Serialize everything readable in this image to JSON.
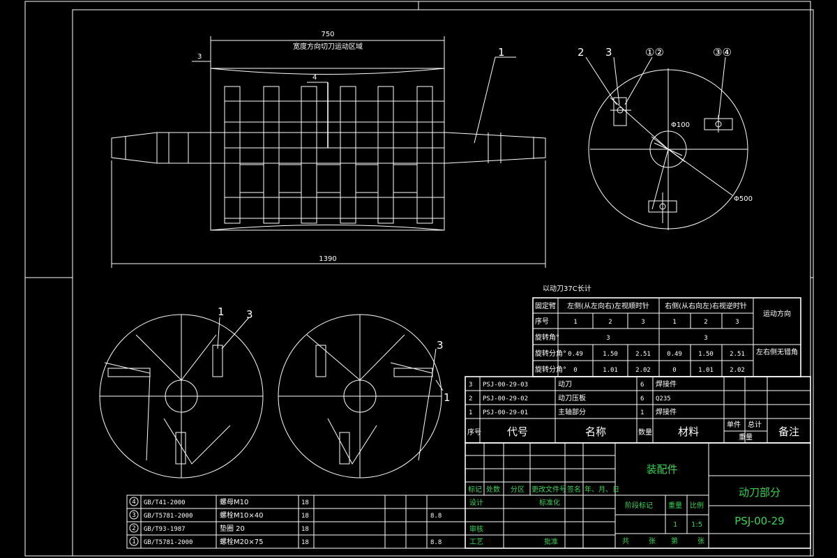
{
  "colors": {
    "background": "#000000",
    "lines": "#ffffff",
    "title_text": "#39d353"
  },
  "front_view": {
    "dim_total_top": "750",
    "region_label": "宽度方向切刀运动区域",
    "dim_gap": "3",
    "dim_slot": "4",
    "dim_total_bottom": "1390",
    "part_callout": "1"
  },
  "side_view": {
    "callouts": [
      "2",
      "3",
      "①②",
      "③④"
    ],
    "dim_shaft": "Φ100",
    "dim_outer": "Φ500"
  },
  "bottom_views": {
    "left_callouts": [
      "1",
      "3"
    ],
    "right_callouts": [
      "3",
      "1"
    ]
  },
  "blade_table": {
    "caption": "以动刀37C长计",
    "header": [
      "固定臂",
      "左侧(从左向右)左视顺时针",
      "右侧(从右向左)右视逆时针"
    ],
    "motion_direction": "运动方向",
    "rows": [
      {
        "label": "序号",
        "cells": [
          "1",
          "2",
          "3",
          "1",
          "2",
          "3"
        ]
      },
      {
        "label": "旋转角°",
        "cells": [
          "3",
          "3"
        ]
      },
      {
        "label": "旋转分角°",
        "cells": [
          "0.49",
          "1.50",
          "2.51",
          "0.49",
          "1.50",
          "2.51"
        ]
      },
      {
        "label": "旋转分角°",
        "cells": [
          "0",
          "1.01",
          "2.02",
          "0",
          "1.01",
          "2.02"
        ]
      }
    ],
    "side_note": "左右侧无错角"
  },
  "bom": {
    "rows": [
      {
        "no": "3",
        "code": "PSJ-00-29-03",
        "name": "动刀",
        "qty": "6",
        "material": "焊接件"
      },
      {
        "no": "2",
        "code": "PSJ-00-29-02",
        "name": "动刀压板",
        "qty": "6",
        "material": "Q235"
      },
      {
        "no": "1",
        "code": "PSJ-00-29-01",
        "name": "主轴部分",
        "qty": "1",
        "material": "焊接件"
      }
    ],
    "header": {
      "no": "序号",
      "code": "代号",
      "name": "名称",
      "qty": "数量",
      "material": "材料",
      "single": "单件",
      "total": "总计",
      "weight": "重量",
      "remark": "备注"
    }
  },
  "standard_parts": [
    {
      "no": "4",
      "code": "GB/T41-2000",
      "name": "螺母M10",
      "qty": "18",
      "material": ""
    },
    {
      "no": "3",
      "code": "GB/T5781-2000",
      "name": "螺栓M10×40",
      "qty": "18",
      "material": "8.8"
    },
    {
      "no": "2",
      "code": "GB/T93-1987",
      "name": "垫圈 20",
      "qty": "18",
      "material": ""
    },
    {
      "no": "1",
      "code": "GB/T5781-2000",
      "name": "螺栓M20×75",
      "qty": "18",
      "material": "8.8"
    }
  ],
  "title_block": {
    "assembly": "装配件",
    "drawing_name": "动刀部分",
    "drawing_no": "PSJ-00-29",
    "rev_headers": [
      "标记",
      "处数",
      "分区",
      "更改文件号",
      "签名",
      "年、月、日"
    ],
    "design": "设计",
    "standardize": "标准化",
    "review": "审核",
    "process": "工艺",
    "approve": "批准",
    "stage_mark": "阶段标记",
    "weight": "重量",
    "scale": "比例",
    "weight_value": "1",
    "scale_value": "1:5",
    "total": "共",
    "sheets": "张",
    "sheet": "第",
    "sheet_end": "张"
  }
}
